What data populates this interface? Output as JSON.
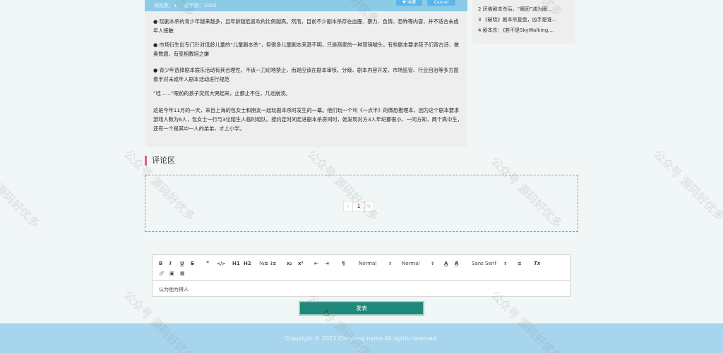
{
  "article": {
    "stats_browse": "浏览数：1",
    "stats_words": "总字数：1000",
    "btn_left": "♥ 收藏",
    "btn_right": "Cancel",
    "p1": "● 玩剧本杀的青少年越来越多，且年龄越低喜欢的比例越高。然而，目前不少剧本杀存在血腥、暴力、色情、恐怖等内容，并不适合未成年人接触",
    "p2": "● 市场衍生出专门针对低龄儿童的“儿童剧本杀”，但很多儿童剧本来源不明，只是商家的一种营销噱头，有些剧本要求孩子们背古诗、做奥数题，有变相教培之嫌",
    "p3": "● 青少年选择剧本娱乐活动有其合理性，不该一刀切地禁止，而是应该在剧本审核、分级、剧本内容开发、市场监管、行业自治等多方面着手对未成年人剧本活动进行规范",
    "p4": "“哇……”眼前的孩子突然大哭起来，止都止不住，几近崩溃。",
    "p5": "这是今年11月的一天，来自上海的包女士和朋友一起玩剧本杀时发生的一幕。他们玩一个叫《一点半》的微恐推理本，因为这个剧本要求游戏人数为6人，包女士一行与3位陌生人临时组队。按约定时间走进剧本杀房间时，她发现对方3人年纪都很小，一问方知，两个高中生，还有一个是其中一人的弟弟，才上小学。"
  },
  "sidebar": {
    "items": [
      "2  厌倦剧本杀后，“瘾团”减为圈...",
      "3  《破晓》剧本杀复盘，凶手是谁...",
      "4  剧本杀：《若不是SkyWalking,..."
    ]
  },
  "comments": {
    "title": "评论区",
    "pager_prev": "‹",
    "pager_current": "1",
    "pager_next": "›"
  },
  "editor": {
    "bold": "B",
    "italic": "I",
    "underline": "U",
    "strike": "S",
    "quote": "❞",
    "code": "</>",
    "h1": "H1",
    "h2": "H2",
    "ol": "⅓≡",
    "ul": "⁝≡",
    "sub": "x₂",
    "sup": "x²",
    "outdent": "⇤",
    "indent": "⇥",
    "rtl": "¶",
    "header_select": "Normal",
    "size_select": "Normal",
    "font_select": "Sans Serif",
    "font_color": "A",
    "bg_color": "A",
    "align": "≡",
    "clean": "Tx",
    "link": "🔗",
    "image": "▣",
    "video": "▦",
    "content": "认为他为得人"
  },
  "submit_label": "发表",
  "footer": {
    "copyright": "Copyright © 2023.Company name All rights reserved."
  },
  "watermark": "公众号 源码好优多"
}
